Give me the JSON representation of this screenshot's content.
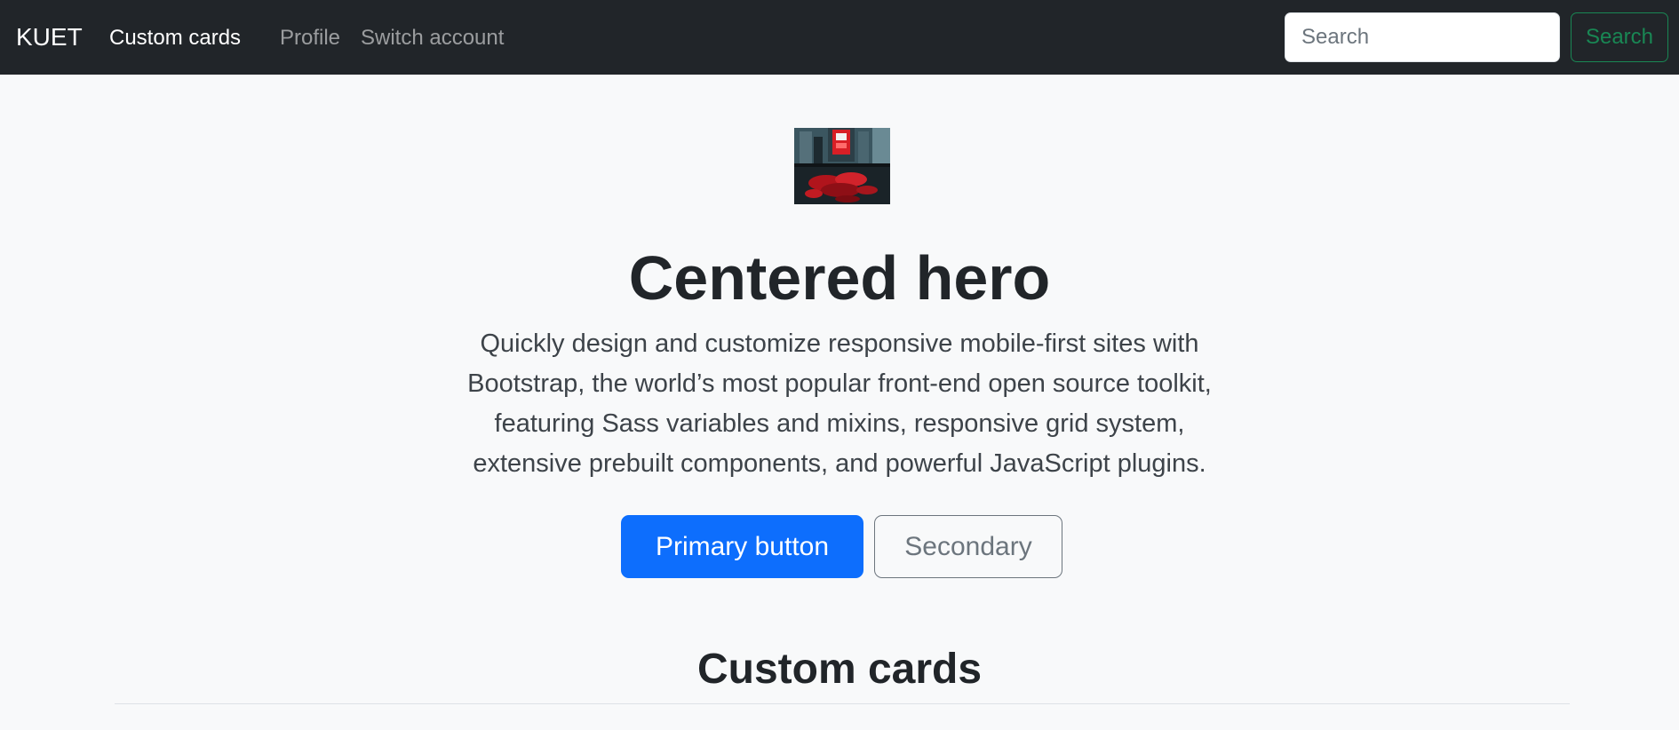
{
  "navbar": {
    "brand": "KUET",
    "links": [
      {
        "label": "Custom cards",
        "active": true
      },
      {
        "label": "Profile",
        "active": false
      },
      {
        "label": "Switch account",
        "active": false
      }
    ],
    "search": {
      "placeholder": "Search",
      "value": "",
      "button_label": "Search"
    }
  },
  "hero": {
    "image_icon": "hero-image",
    "title": "Centered hero",
    "lead": "Quickly design and customize responsive mobile-first sites with Bootstrap, the world’s most popular front-end open source toolkit, featuring Sass variables and mixins, responsive grid system, extensive prebuilt components, and powerful JavaScript plugins.",
    "primary_button": "Primary button",
    "secondary_button": "Secondary"
  },
  "section": {
    "title": "Custom cards"
  },
  "colors": {
    "navbar_bg": "#212529",
    "page_bg": "#f8f9fa",
    "primary": "#0d6efd",
    "success": "#198754",
    "secondary": "#6c757d"
  }
}
